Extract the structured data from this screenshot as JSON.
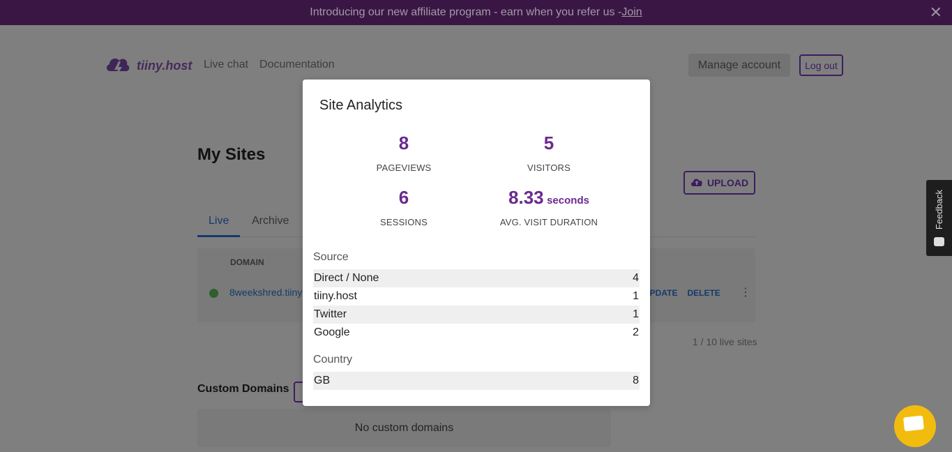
{
  "banner": {
    "text": "Introducing our new affiliate program - earn when you refer us -",
    "link": "Join"
  },
  "header": {
    "logo_text": "tiiny.host",
    "nav": [
      "Live chat",
      "Documentation"
    ],
    "manage_account": "Manage account",
    "logout": "Log out"
  },
  "main": {
    "title": "My Sites",
    "upload": "UPLOAD",
    "tabs": [
      "Live",
      "Archive"
    ],
    "table_header_domain": "DOMAIN",
    "site_domain": "8weekshred.tiiny",
    "row_actions": [
      "UPDATE",
      "DELETE"
    ],
    "live_count": "1 / 10 live sites",
    "custom_domains_title": "Custom Domains",
    "no_custom_domains": "No custom domains"
  },
  "feedback": {
    "label": "Feedback"
  },
  "modal": {
    "title": "Site Analytics",
    "stats": [
      {
        "value": "8",
        "unit": "",
        "label": "PAGEVIEWS"
      },
      {
        "value": "5",
        "unit": "",
        "label": "VISITORS"
      },
      {
        "value": "6",
        "unit": "",
        "label": "SESSIONS"
      },
      {
        "value": "8.33",
        "unit": "seconds",
        "label": "AVG. VISIT DURATION"
      }
    ],
    "source_label": "Source",
    "sources": [
      {
        "name": "Direct / None",
        "count": "4"
      },
      {
        "name": "tiiny.host",
        "count": "1"
      },
      {
        "name": "Twitter",
        "count": "1"
      },
      {
        "name": "Google",
        "count": "2"
      }
    ],
    "country_label": "Country",
    "countries": [
      {
        "name": "GB",
        "count": "8"
      }
    ]
  },
  "colors": {
    "accent": "#6a2a8c",
    "link": "#1565c0",
    "overlay": "#7f7f7f"
  }
}
